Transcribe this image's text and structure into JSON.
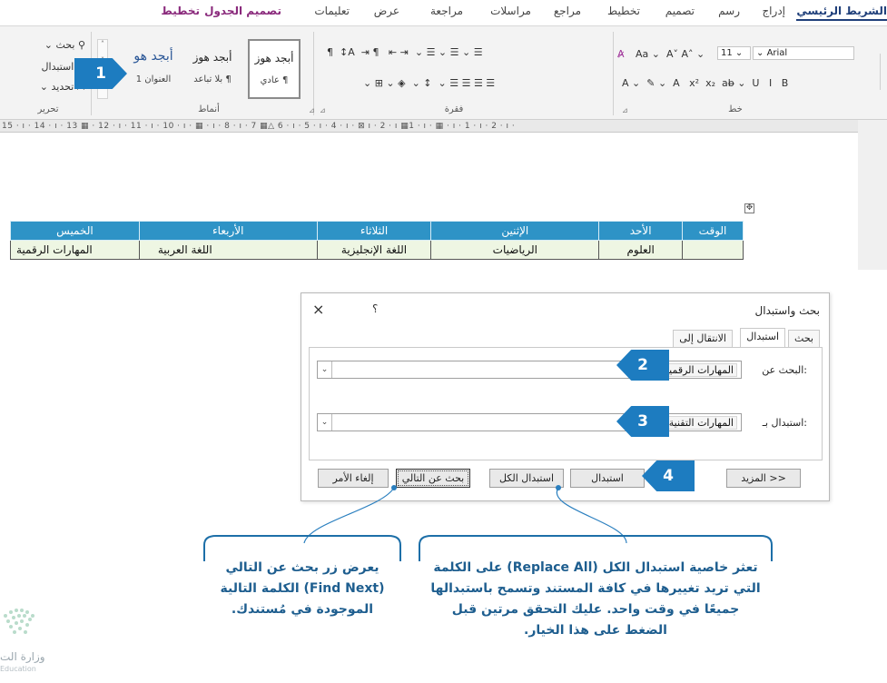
{
  "ribbon": {
    "tabs": [
      {
        "label": "الشريط الرئيسي",
        "active": true
      },
      {
        "label": "إدراج"
      },
      {
        "label": "رسم"
      },
      {
        "label": "تصميم"
      },
      {
        "label": "تخطيط"
      },
      {
        "label": "مراجع"
      },
      {
        "label": "مراسلات"
      },
      {
        "label": "مراجعة"
      },
      {
        "label": "عرض"
      },
      {
        "label": "تعليمات"
      },
      {
        "label": "تصميم الجدول",
        "contextual": true
      },
      {
        "label": "تخطيط",
        "contextual": true
      }
    ],
    "font": {
      "name": "Arial",
      "size": "11",
      "group_label": "خط"
    },
    "paragraph": {
      "group_label": "فقرة"
    },
    "styles": {
      "group_label": "أنماط",
      "items": [
        {
          "sample": "أبجد هوز",
          "name": "¶ عادي"
        },
        {
          "sample": "أبجد هوز",
          "name": "¶ بلا تباعد"
        },
        {
          "sample": "أبجد هو",
          "name": "العنوان 1"
        }
      ]
    },
    "editing": {
      "group_label": "تحرير",
      "find": "بحث",
      "replace": "استبدال",
      "select": "تحديد"
    }
  },
  "ruler_text": "15 · ı · 14 · ı · 13 ▦ · 12 · ı · 11 · ı · 10 · ı · ▦ · ı · 8 · ı · 7 ▦△ 6 · ı · 5 · ı · 4 · ı · ⊠ ı · 2 · ı ▦1 · ı · ▦ · ı · 1 · ı · 2 · ı ·",
  "schedule": {
    "headers": [
      "الوقت",
      "الأحد",
      "الإثنين",
      "الثلاثاء",
      "الأربعاء",
      "الخميس"
    ],
    "row": [
      "",
      "العلوم",
      "الرياضيات",
      "اللغة الإنجليزية",
      "اللغة العربية",
      "المهارات الرقمية"
    ]
  },
  "dialog": {
    "title": "بحث واستبدال",
    "close": "×",
    "help": "؟",
    "tabs": [
      "بحث",
      "استبدال",
      "الانتقال إلى"
    ],
    "find_label": "البحث عن:",
    "find_value": "المهارات الرقمية",
    "replace_label": "استبدال بـ:",
    "replace_value": "المهارات التقنية",
    "buttons": {
      "more": "المزيد >>",
      "replace": "استبدال",
      "replace_all": "استبدال الكل",
      "find_next": "بحث عن التالي",
      "cancel": "إلغاء الأمر"
    }
  },
  "steps": [
    "1",
    "2",
    "3",
    "4"
  ],
  "callouts": {
    "replace_all": "تعثر خاصية استبدال الكل (Replace All) على الكلمة التي تريد تغييرها في كافة المستند وتسمح باستبدالها جميعًا في وقت واحد. عليك التحقق مرتين قبل الضغط على هذا الخيار.",
    "find_next": "يعرض زر بحث عن التالي (Find Next) الكلمة التالية الموجودة في مُستندك."
  },
  "ministry": {
    "name": "وزارة الت",
    "sub": "Education"
  },
  "colors": {
    "table_header": "#2e93c6",
    "table_row": "#eef6e3",
    "badge": "#1d7cc0",
    "callout_text": "#1e5e8f"
  }
}
